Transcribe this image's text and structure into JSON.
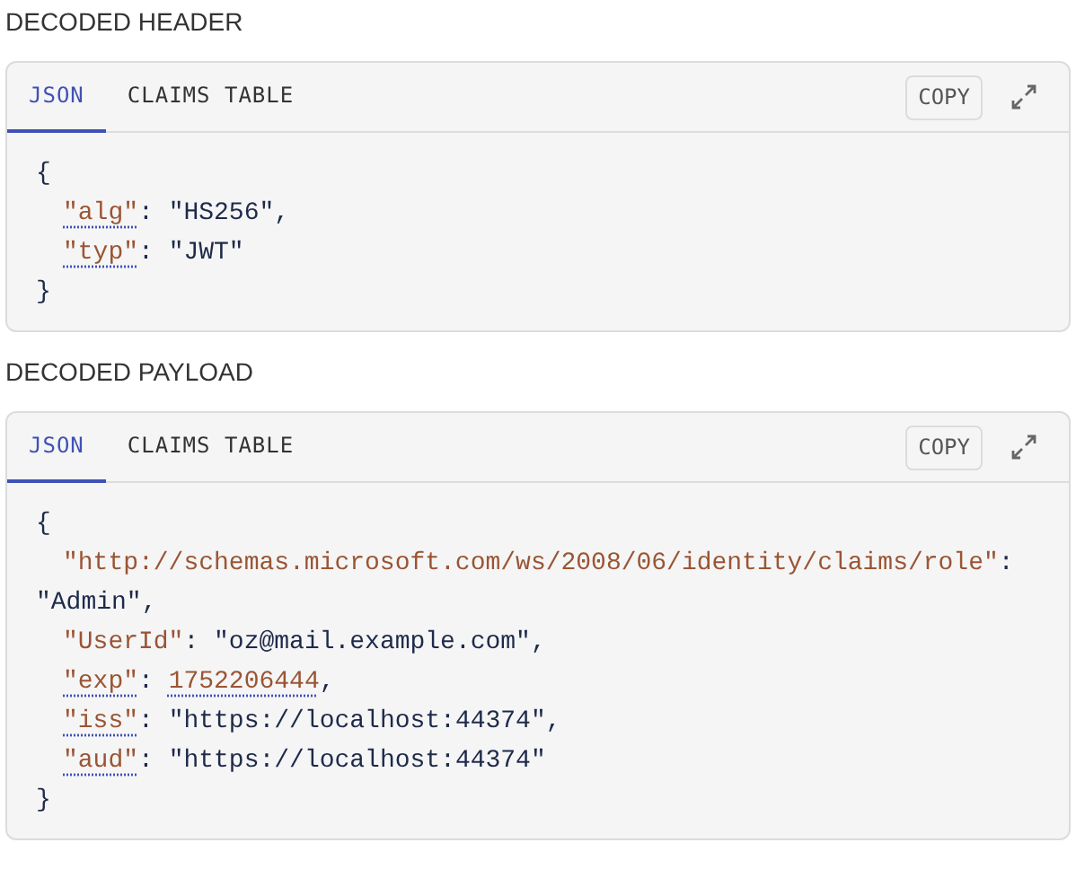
{
  "sections": [
    {
      "title": "DECODED HEADER",
      "tabs": [
        {
          "label": "JSON",
          "selected": true
        },
        {
          "label": "CLAIMS TABLE",
          "selected": false
        }
      ],
      "copy_button": "COPY",
      "open": "{",
      "close": "}",
      "entries": [
        {
          "key": "\"alg\"",
          "sep": ":",
          "value": "\"HS256\"",
          "end": ",",
          "kind": "string",
          "key_underlined": true,
          "value_underlined": false
        },
        {
          "key": "\"typ\"",
          "sep": ":",
          "value": "\"JWT\"",
          "kind": "string",
          "key_underlined": true,
          "value_underlined": false
        }
      ]
    },
    {
      "title": "DECODED PAYLOAD",
      "tabs": [
        {
          "label": "JSON",
          "selected": true
        },
        {
          "label": "CLAIMS TABLE",
          "selected": false
        }
      ],
      "copy_button": "COPY",
      "open": "{",
      "close": "}",
      "entries": [
        {
          "key": "\"http://schemas.microsoft.com/ws/2008/06/identity/claims/role\"",
          "sep": ":",
          "value": "\"Admin\"",
          "end": ",",
          "kind": "string",
          "key_underlined": false,
          "value_underlined": false
        },
        {
          "key": "\"UserId\"",
          "sep": ":",
          "value": "\"oz@mail.example.com\"",
          "end": ",",
          "kind": "string",
          "key_underlined": false,
          "value_underlined": false
        },
        {
          "key": "\"exp\"",
          "sep": ":",
          "value": "1752206444",
          "end": ",",
          "kind": "number",
          "key_underlined": true,
          "value_underlined": true
        },
        {
          "key": "\"iss\"",
          "sep": ":",
          "value": "\"https://localhost:44374\"",
          "end": ",",
          "kind": "string",
          "key_underlined": true,
          "value_underlined": false
        },
        {
          "key": "\"aud\"",
          "sep": ":",
          "value": "\"https://localhost:44374\"",
          "kind": "string",
          "key_underlined": true,
          "value_underlined": false
        }
      ]
    }
  ]
}
